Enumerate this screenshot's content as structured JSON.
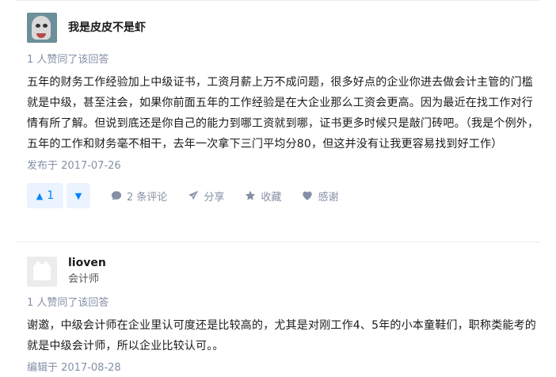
{
  "answers": [
    {
      "author": "我是皮皮不是虾",
      "votes_text": "1 人赞同了该回答",
      "content": "五年的财务工作经验加上中级证书，工资月薪上万不成问题，很多好点的企业你进去做会计主管的门槛就是中级，甚至注会，如果你前面五年的工作经验是在大企业那么工资会更高。因为最近在找工作对行情有所了解。但说到底还是你自己的能力到哪工资就到哪，证书更多时候只是敲门砖吧。（我是个例外，五年的工作和财务毫不相干，去年一次拿下三门平均分80，但这并没有让我更容易找到好工作）",
      "date": "发布于 2017-07-26",
      "vote_count": "1",
      "comments": "2 条评论",
      "share": "分享",
      "favorite": "收藏",
      "thanks": "感谢"
    },
    {
      "author": "lioven",
      "title": "会计师",
      "votes_text": "1 人赞同了该回答",
      "content": "谢邀，中级会计师在企业里认可度还是比较高的，尤其是对刚工作4、5年的小本童鞋们，职称类能考的就是中级会计师，所以企业比较认可。。",
      "date": "编辑于 2017-08-28"
    }
  ],
  "icons": {
    "vote_up": "triangle-up-icon",
    "vote_down": "triangle-down-icon",
    "comment": "comment-bubble-icon",
    "share": "paper-plane-icon",
    "favorite": "star-icon",
    "thanks": "heart-icon"
  },
  "colors": {
    "accent": "#0084ff",
    "vote_bg": "#eaf3fe",
    "meta": "#8590a6",
    "text": "#1a1a1a"
  }
}
